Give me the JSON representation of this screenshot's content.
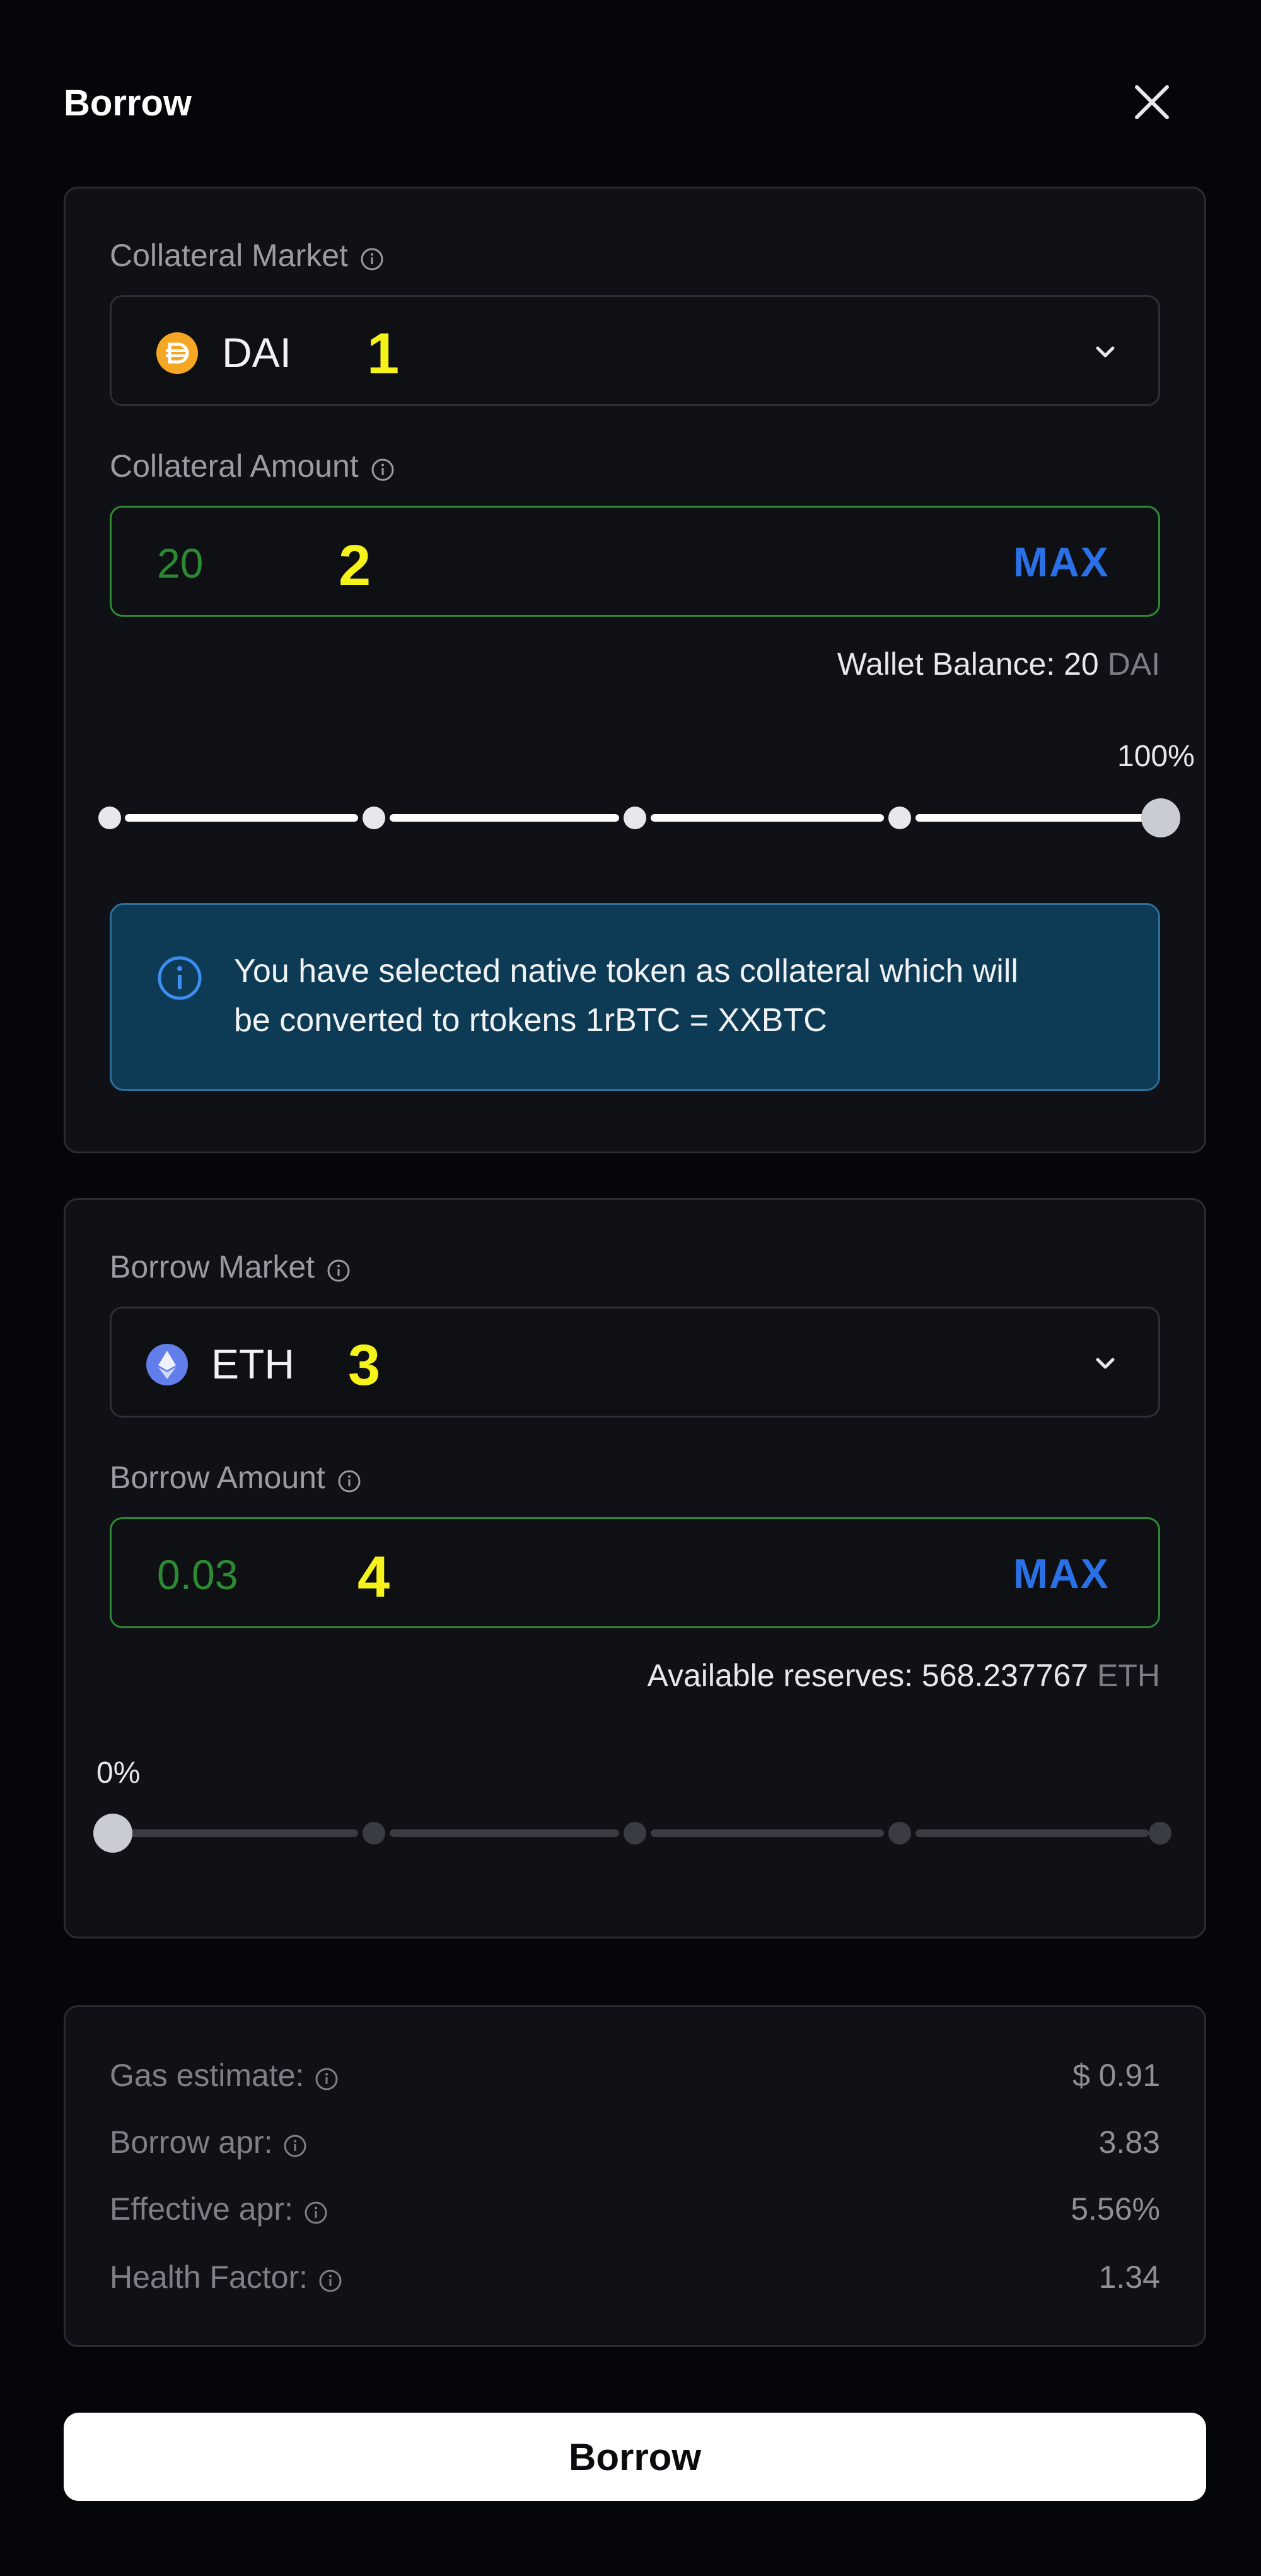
{
  "header": {
    "title": "Borrow"
  },
  "collateral": {
    "market_label": "Collateral Market",
    "market_value": "DAI",
    "market_annotation": "1",
    "amount_label": "Collateral Amount",
    "amount_value": "20",
    "amount_annotation": "2",
    "max_label": "MAX",
    "balance_prefix": "Wallet Balance: 20",
    "balance_unit": "DAI",
    "slider_percent_text": "100%",
    "slider_fraction": 1.0,
    "info_text_line1": "You have selected native token as collateral which will",
    "info_text_line2": "be converted to rtokens 1rBTC = XXBTC"
  },
  "borrow": {
    "market_label": "Borrow Market",
    "market_value": "ETH",
    "market_annotation": "3",
    "amount_label": "Borrow Amount",
    "amount_value": "0.03",
    "amount_annotation": "4",
    "max_label": "MAX",
    "reserves_prefix": "Available reserves: 568.237767",
    "reserves_unit": "ETH",
    "slider_percent_text": "0%",
    "slider_fraction": 0.0
  },
  "stats": [
    {
      "label": "Gas estimate:",
      "value": "$ 0.91"
    },
    {
      "label": "Borrow apr:",
      "value": "3.83"
    },
    {
      "label": "Effective apr:",
      "value": "5.56%"
    },
    {
      "label": "Health Factor:",
      "value": "1.34"
    }
  ],
  "action": {
    "submit_label": "Borrow"
  },
  "colors": {
    "background": "#05060a",
    "card": "#101116",
    "input_border_green": "#2f8a36",
    "max_blue": "#2a71e8",
    "banner_bg": "#0d3b55",
    "annotation_yellow": "#f6f31a",
    "dai_orange": "#f5a623",
    "eth_purple": "#627eea"
  },
  "icons": {
    "close": "close-icon",
    "info": "info-icon",
    "chevron": "chevron-down-icon",
    "dai": "dai-token-icon",
    "eth": "eth-token-icon"
  }
}
